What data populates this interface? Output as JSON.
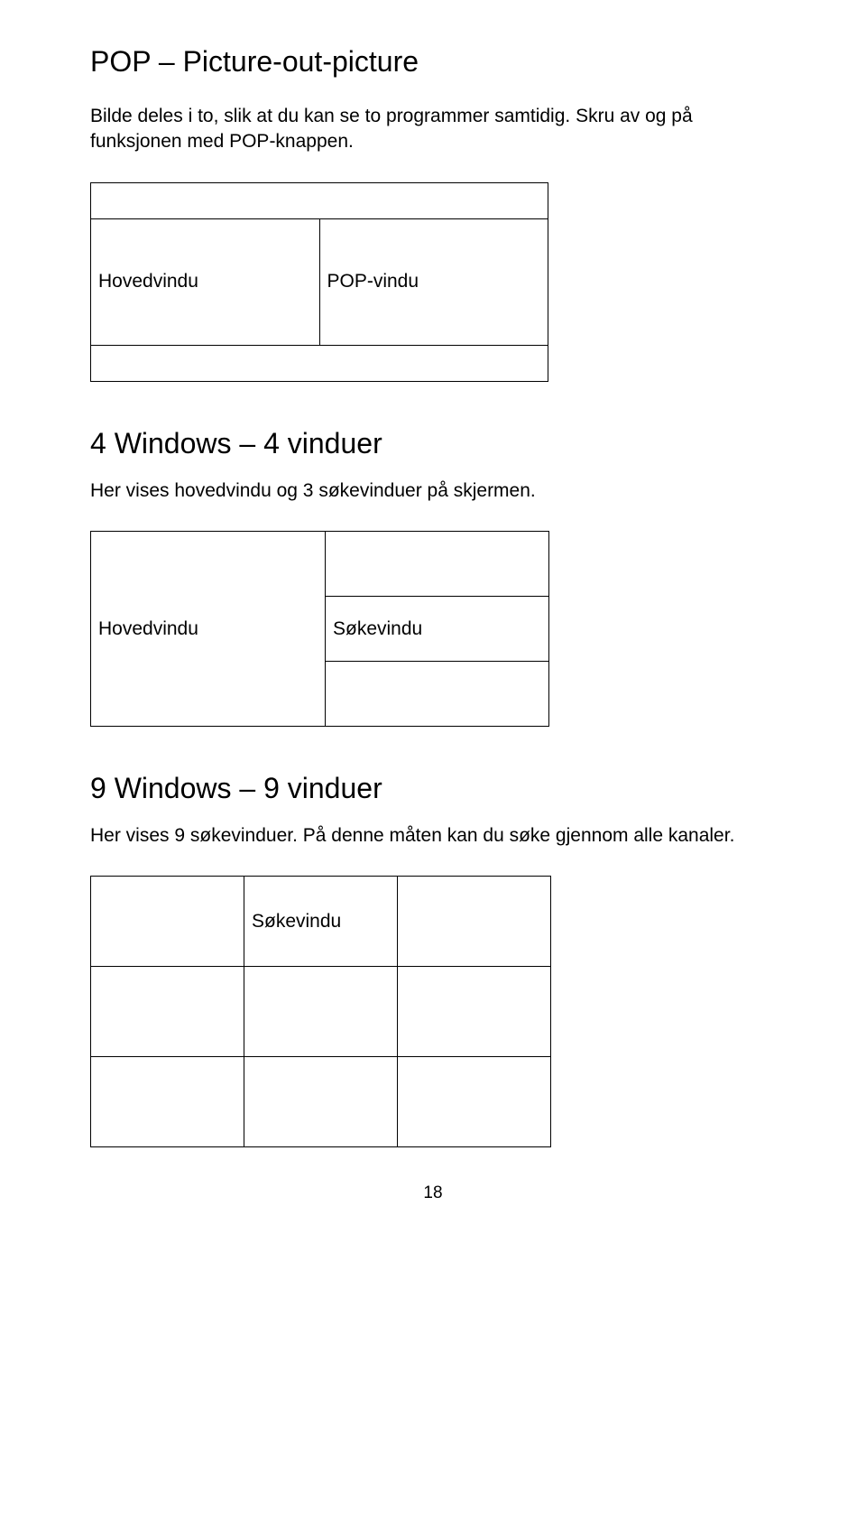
{
  "pop": {
    "heading": "POP – Picture-out-picture",
    "body": "Bilde deles i to, slik at du kan se to programmer samtidig. Skru av og på funksjonen med POP-knappen.",
    "left_label": "Hovedvindu",
    "right_label": "POP-vindu"
  },
  "four": {
    "heading": "4 Windows – 4 vinduer",
    "body": "Her vises hovedvindu og 3 søkevinduer på skjermen.",
    "left_label": "Hovedvindu",
    "right_label": "Søkevindu"
  },
  "nine": {
    "heading": "9 Windows – 9 vinduer",
    "body": "Her vises 9 søkevinduer. På denne måten kan du søke gjennom alle kanaler.",
    "cell_label": "Søkevindu"
  },
  "page_number": "18"
}
